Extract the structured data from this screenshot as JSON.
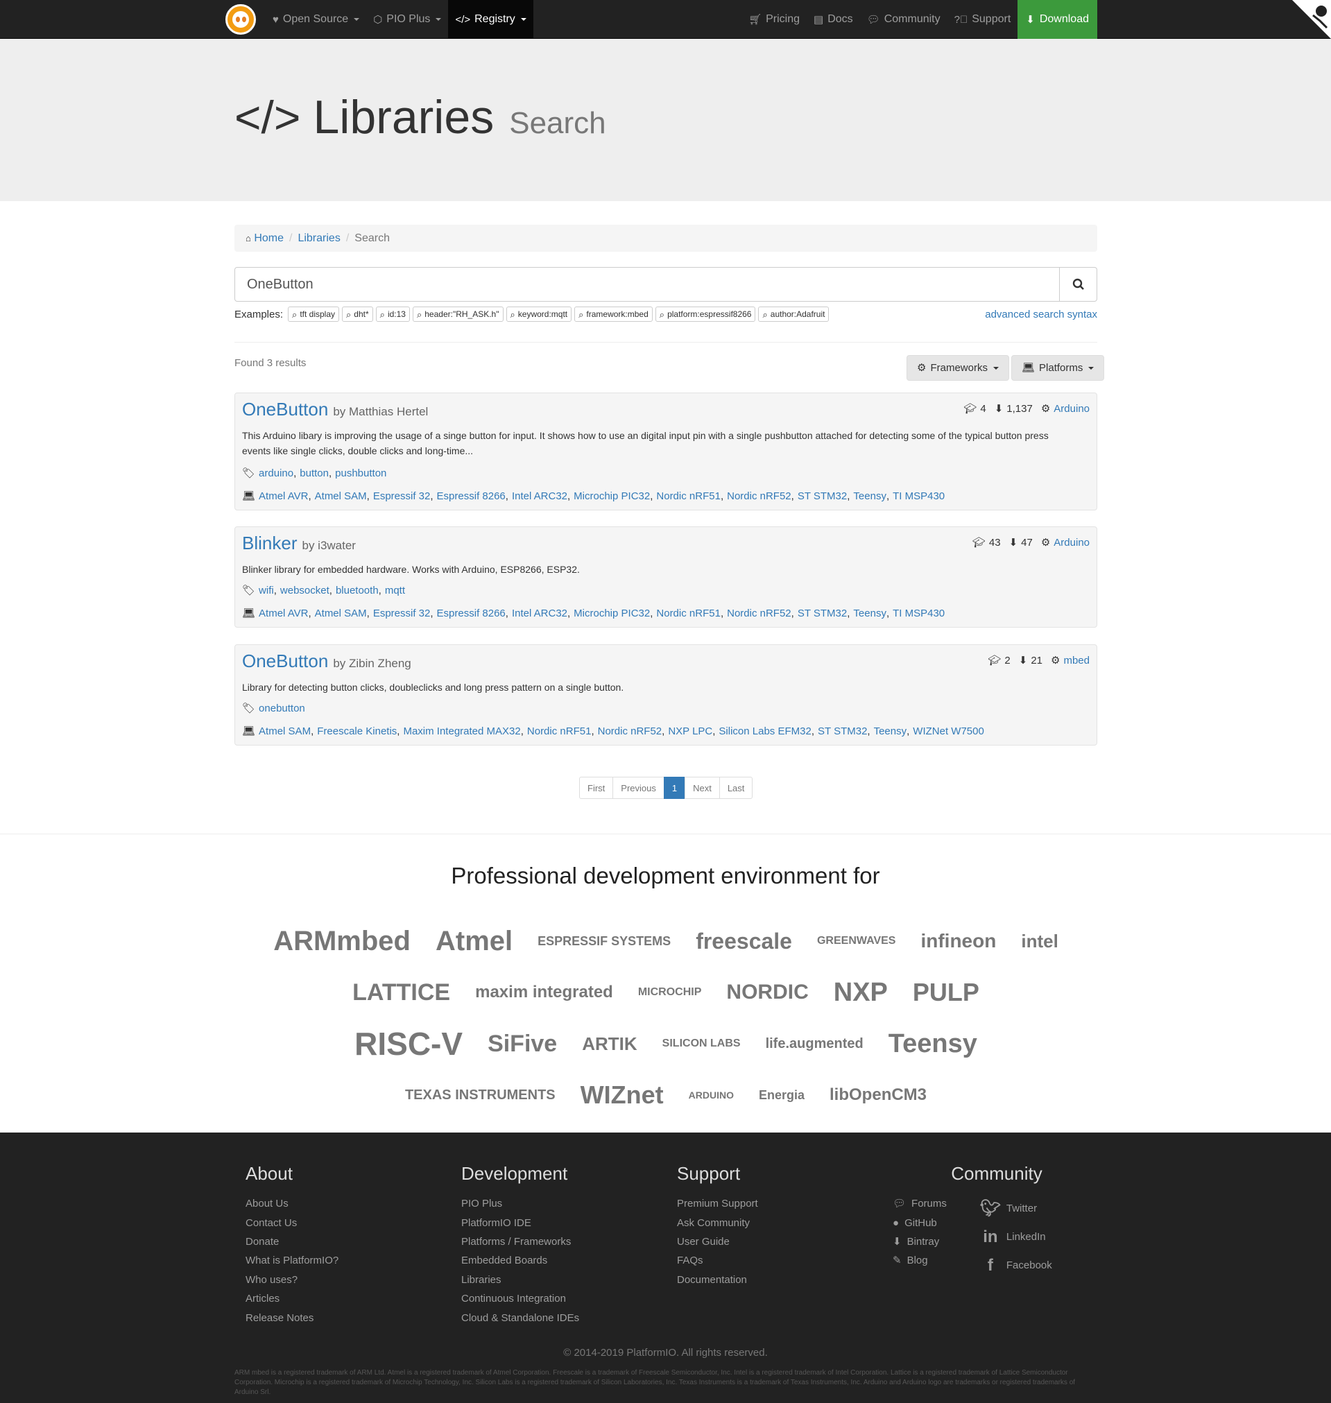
{
  "nav": {
    "items": [
      {
        "label": "Open Source",
        "icon": "heart-icon"
      },
      {
        "label": "PIO Plus",
        "icon": "cube-icon"
      },
      {
        "label": "Registry",
        "icon": "code-icon"
      }
    ],
    "right": [
      {
        "label": "Pricing",
        "icon": "cart-icon"
      },
      {
        "label": "Docs",
        "icon": "book-icon"
      },
      {
        "label": "Community",
        "icon": "comments-icon"
      },
      {
        "label": "Support",
        "icon": "question-icon"
      }
    ],
    "download": "Download"
  },
  "jumbo": {
    "code": "</>",
    "title": "Libraries",
    "subtitle": "Search"
  },
  "breadcrumb": {
    "home": "Home",
    "libraries": "Libraries",
    "current": "Search"
  },
  "search": {
    "value": "OneButton"
  },
  "examples": {
    "label": "Examples:",
    "items": [
      "tft display",
      "dht*",
      "id:13",
      "header:\"RH_ASK.h\"",
      "keyword:mqtt",
      "framework:mbed",
      "platform:espressif8266",
      "author:Adafruit"
    ],
    "advanced": "advanced search syntax"
  },
  "results": {
    "found": "Found 3 results",
    "frameworks": "Frameworks",
    "platforms": "Platforms",
    "items": [
      {
        "name": "OneButton",
        "by": "by Matthias Hertel",
        "examples": "4",
        "downloads": "1,137",
        "framework": "Arduino",
        "desc": "This Arduino libary is improving the usage of a singe button for input. It shows how to use an digital input pin with a single pushbutton attached for detecting some of the typical button press events like single clicks, double clicks and long-time...",
        "tags": [
          "arduino",
          "button",
          "pushbutton"
        ],
        "platforms": [
          "Atmel AVR",
          "Atmel SAM",
          "Espressif 32",
          "Espressif 8266",
          "Intel ARC32",
          "Microchip PIC32",
          "Nordic nRF51",
          "Nordic nRF52",
          "ST STM32",
          "Teensy",
          "TI MSP430"
        ]
      },
      {
        "name": "Blinker",
        "by": "by i3water",
        "examples": "43",
        "downloads": "47",
        "framework": "Arduino",
        "desc": "Blinker library for embedded hardware. Works with Arduino, ESP8266, ESP32.",
        "tags": [
          "wifi",
          "websocket",
          "bluetooth",
          "mqtt"
        ],
        "platforms": [
          "Atmel AVR",
          "Atmel SAM",
          "Espressif 32",
          "Espressif 8266",
          "Intel ARC32",
          "Microchip PIC32",
          "Nordic nRF51",
          "Nordic nRF52",
          "ST STM32",
          "Teensy",
          "TI MSP430"
        ]
      },
      {
        "name": "OneButton",
        "by": "by Zibin Zheng",
        "examples": "2",
        "downloads": "21",
        "framework": "mbed",
        "desc": "Library for detecting button clicks, doubleclicks and long press pattern on a single button.",
        "tags": [
          "onebutton"
        ],
        "platforms": [
          "Atmel SAM",
          "Freescale Kinetis",
          "Maxim Integrated MAX32",
          "Nordic nRF51",
          "Nordic nRF52",
          "NXP LPC",
          "Silicon Labs EFM32",
          "ST STM32",
          "Teensy",
          "WIZNet W7500"
        ]
      }
    ]
  },
  "pager": [
    "First",
    "Previous",
    "1",
    "Next",
    "Last"
  ],
  "pro": {
    "title": "Professional development environment for",
    "rows": [
      [
        "ARMmbed",
        "Atmel",
        "ESPRESSIF SYSTEMS",
        "freescale",
        "GREENWAVES",
        "infineon",
        "intel"
      ],
      [
        "LATTICE",
        "maxim integrated",
        "MICROCHIP",
        "NORDIC",
        "NXP",
        "PULP"
      ],
      [
        "RISC-V",
        "SiFive",
        "ARTIK",
        "SILICON LABS",
        "life.augmented",
        "Teensy"
      ],
      [
        "TEXAS INSTRUMENTS",
        "WIZnet",
        "ARDUINO",
        "Energia",
        "libOpenCM3"
      ]
    ]
  },
  "footer": {
    "about": {
      "title": "About",
      "links": [
        "About Us",
        "Contact Us",
        "Donate",
        "What is PlatformIO?",
        "Who uses?",
        "Articles",
        "Release Notes"
      ]
    },
    "development": {
      "title": "Development",
      "links": [
        "PIO Plus",
        "PlatformIO IDE",
        "Platforms / Frameworks",
        "Embedded Boards",
        "Libraries",
        "Continuous Integration",
        "Cloud & Standalone IDEs"
      ]
    },
    "support": {
      "title": "Support",
      "links": [
        "Premium Support",
        "Ask Community",
        "User Guide",
        "FAQs",
        "Documentation"
      ]
    },
    "community": {
      "title": "Community",
      "links": [
        "Forums",
        "GitHub",
        "Bintray",
        "Blog"
      ],
      "social": [
        "Twitter",
        "LinkedIn",
        "Facebook"
      ]
    },
    "copyright": "© 2014-2019 PlatformIO. All rights reserved.",
    "legal": "ARM mbed is a registered trademark of ARM Ltd. Atmel is a registered trademark of Atmel Corporation. Freescale is a trademark of Freescale Semiconductor, Inc. Intel is a registered trademark of Intel Corporation. Lattice is a registered trademark of Lattice Semiconductor Corporation. Microchip is a registered trademark of Microchip Technology, Inc. Silicon Labs is a registered trademark of Silicon Laboratories, Inc. Texas Instruments is a trademark of Texas Instruments, Inc. Arduino and Arduino logo are trademarks or registered trademarks of Arduino Srl."
  }
}
